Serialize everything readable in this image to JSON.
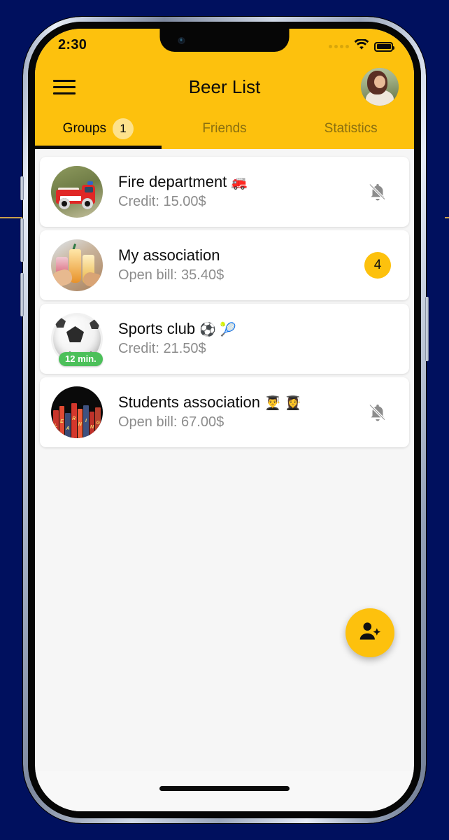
{
  "backdrop": {
    "color": "#00105e"
  },
  "theme": {
    "accent": "#fdc10d",
    "badge_light": "#fde28c",
    "screen_bg": "#f6f6f6",
    "card_bg": "#ffffff",
    "muted_text": "#8c8c8c",
    "green_badge": "#4cc05a"
  },
  "statusbar": {
    "time": "2:30",
    "signal_icon": "signal-dots-icon",
    "wifi_icon": "wifi-icon",
    "battery_icon": "battery-full-icon",
    "camera_icon": "front-camera-icon"
  },
  "appbar": {
    "menu_icon": "hamburger-menu-icon",
    "title": "Beer List",
    "avatar_icon": "user-avatar"
  },
  "tabs": [
    {
      "label": "Groups",
      "badge": "1",
      "active": true
    },
    {
      "label": "Friends",
      "badge": null,
      "active": false
    },
    {
      "label": "Statistics",
      "badge": null,
      "active": false
    }
  ],
  "groups": [
    {
      "name": "Fire department",
      "emoji": "🚒",
      "subtitle": "Credit: 15.00$",
      "thumb": "fire-truck-photo",
      "time_badge": null,
      "right_icon": "notifications-off-icon",
      "right_badge": null
    },
    {
      "name": "My association",
      "emoji": "",
      "subtitle": "Open bill: 35.40$",
      "thumb": "cheers-drinks-photo",
      "time_badge": null,
      "right_icon": null,
      "right_badge": "4"
    },
    {
      "name": "Sports club",
      "emoji": "⚽ 🎾",
      "subtitle": "Credit: 21.50$",
      "thumb": "soccer-ball-photo",
      "time_badge": "12 min.",
      "right_icon": null,
      "right_badge": null
    },
    {
      "name": "Students association",
      "emoji": "👨‍🎓 👩‍🎓",
      "subtitle": "Open bill: 67.00$",
      "thumb": "books-photo",
      "time_badge": null,
      "right_icon": "notifications-off-icon",
      "right_badge": null
    }
  ],
  "fab": {
    "icon": "person-add-icon",
    "label": ""
  },
  "home_indicator": {
    "icon": "home-indicator"
  }
}
